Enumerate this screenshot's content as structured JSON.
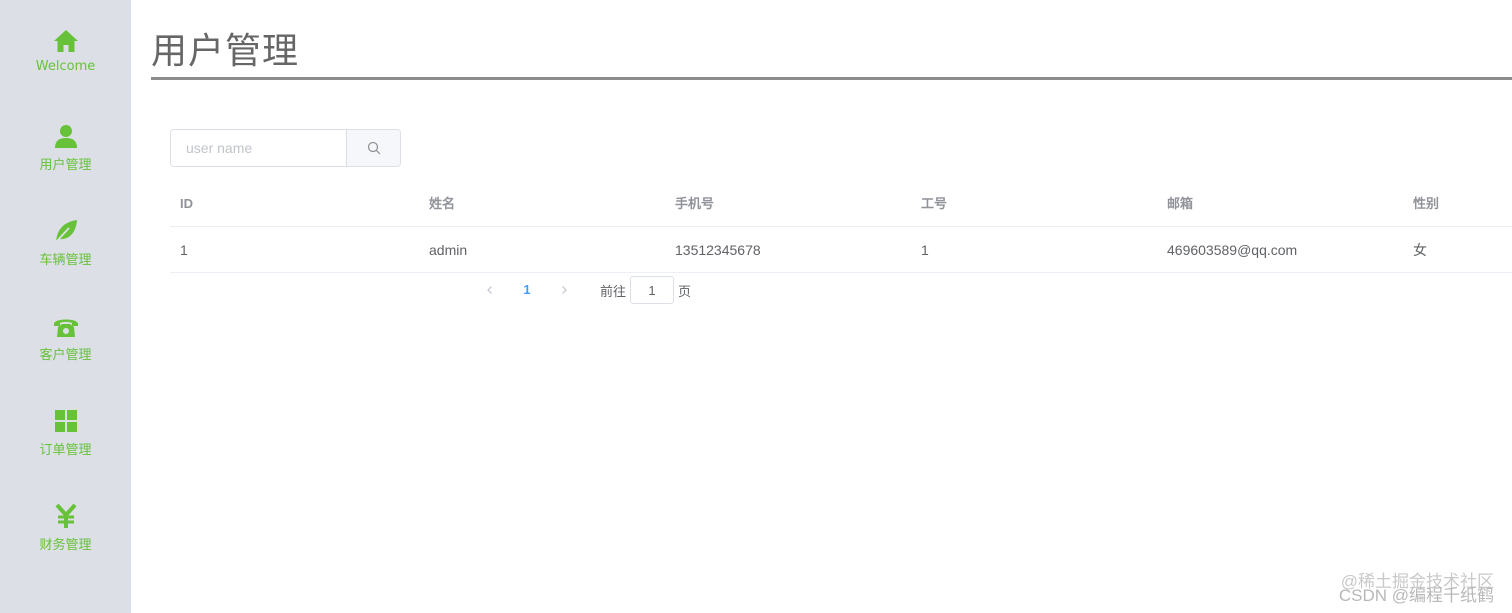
{
  "sidebar": {
    "items": [
      {
        "label": "Welcome",
        "icon": "home-icon"
      },
      {
        "label": "用户管理",
        "icon": "user-icon"
      },
      {
        "label": "车辆管理",
        "icon": "leaf-icon"
      },
      {
        "label": "客户管理",
        "icon": "phone-icon"
      },
      {
        "label": "订单管理",
        "icon": "grid-icon"
      },
      {
        "label": "财务管理",
        "icon": "yen-icon"
      }
    ],
    "accent_color": "#67c23a"
  },
  "page": {
    "title": "用户管理"
  },
  "search": {
    "placeholder": "user name",
    "value": ""
  },
  "table": {
    "columns": [
      "ID",
      "姓名",
      "手机号",
      "工号",
      "邮箱",
      "性别"
    ],
    "rows": [
      [
        "1",
        "admin",
        "13512345678",
        "1",
        "469603589@qq.com",
        "女"
      ]
    ]
  },
  "pagination": {
    "current_page": "1",
    "goto_prefix": "前往",
    "goto_value": "1",
    "goto_suffix": "页"
  },
  "watermark": {
    "line1": "@稀土掘金技术社区",
    "line2": "CSDN @编程千纸鹤"
  }
}
